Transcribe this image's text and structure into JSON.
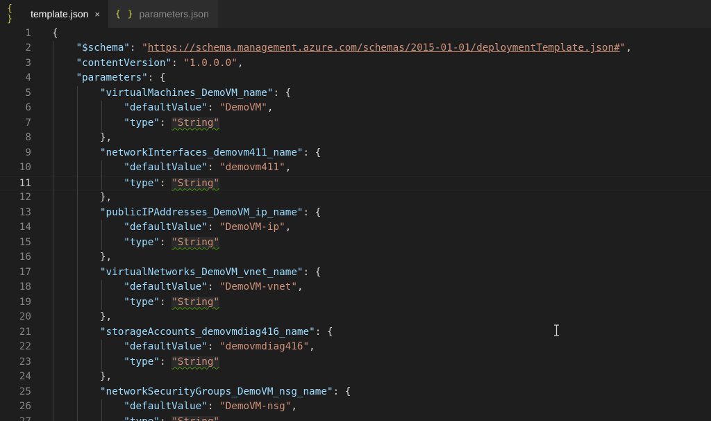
{
  "tabs": [
    {
      "icon": "{ }",
      "label": "template.json",
      "active": true,
      "close": "×"
    },
    {
      "icon": "{ }",
      "label": "parameters.json",
      "active": false
    }
  ],
  "editor": {
    "current_line": 11,
    "lines": [
      {
        "n": "1",
        "parts": [
          [
            "p",
            "{"
          ]
        ]
      },
      {
        "n": "2",
        "parts": [
          [
            "p",
            "    "
          ],
          [
            "k",
            "\"$schema\""
          ],
          [
            "p",
            ": "
          ],
          [
            "s",
            "\""
          ],
          [
            "u",
            "https://schema.management.azure.com/schemas/2015-01-01/deploymentTemplate.json#"
          ],
          [
            "s",
            "\""
          ],
          [
            "p",
            ","
          ]
        ]
      },
      {
        "n": "3",
        "parts": [
          [
            "p",
            "    "
          ],
          [
            "k",
            "\"contentVersion\""
          ],
          [
            "p",
            ": "
          ],
          [
            "s",
            "\"1.0.0.0\""
          ],
          [
            "p",
            ","
          ]
        ]
      },
      {
        "n": "4",
        "parts": [
          [
            "p",
            "    "
          ],
          [
            "k",
            "\"parameters\""
          ],
          [
            "p",
            ": {"
          ]
        ]
      },
      {
        "n": "5",
        "parts": [
          [
            "p",
            "        "
          ],
          [
            "k",
            "\"virtualMachines_DemoVM_name\""
          ],
          [
            "p",
            ": {"
          ]
        ]
      },
      {
        "n": "6",
        "parts": [
          [
            "p",
            "            "
          ],
          [
            "k",
            "\"defaultValue\""
          ],
          [
            "p",
            ": "
          ],
          [
            "s",
            "\"DemoVM\""
          ],
          [
            "p",
            ","
          ]
        ]
      },
      {
        "n": "7",
        "parts": [
          [
            "p",
            "            "
          ],
          [
            "k",
            "\"type\""
          ],
          [
            "p",
            ": "
          ],
          [
            "q",
            "\"String\""
          ]
        ]
      },
      {
        "n": "8",
        "parts": [
          [
            "p",
            "        },"
          ]
        ]
      },
      {
        "n": "9",
        "parts": [
          [
            "p",
            "        "
          ],
          [
            "k",
            "\"networkInterfaces_demovm411_name\""
          ],
          [
            "p",
            ": {"
          ]
        ]
      },
      {
        "n": "10",
        "parts": [
          [
            "p",
            "            "
          ],
          [
            "k",
            "\"defaultValue\""
          ],
          [
            "p",
            ": "
          ],
          [
            "s",
            "\"demovm411\""
          ],
          [
            "p",
            ","
          ]
        ]
      },
      {
        "n": "11",
        "parts": [
          [
            "p",
            "            "
          ],
          [
            "k",
            "\"type\""
          ],
          [
            "p",
            ": "
          ],
          [
            "q",
            "\"String\""
          ]
        ]
      },
      {
        "n": "12",
        "parts": [
          [
            "p",
            "        },"
          ]
        ]
      },
      {
        "n": "13",
        "parts": [
          [
            "p",
            "        "
          ],
          [
            "k",
            "\"publicIPAddresses_DemoVM_ip_name\""
          ],
          [
            "p",
            ": {"
          ]
        ]
      },
      {
        "n": "14",
        "parts": [
          [
            "p",
            "            "
          ],
          [
            "k",
            "\"defaultValue\""
          ],
          [
            "p",
            ": "
          ],
          [
            "s",
            "\"DemoVM-ip\""
          ],
          [
            "p",
            ","
          ]
        ]
      },
      {
        "n": "15",
        "parts": [
          [
            "p",
            "            "
          ],
          [
            "k",
            "\"type\""
          ],
          [
            "p",
            ": "
          ],
          [
            "q",
            "\"String\""
          ]
        ]
      },
      {
        "n": "16",
        "parts": [
          [
            "p",
            "        },"
          ]
        ]
      },
      {
        "n": "17",
        "parts": [
          [
            "p",
            "        "
          ],
          [
            "k",
            "\"virtualNetworks_DemoVM_vnet_name\""
          ],
          [
            "p",
            ": {"
          ]
        ]
      },
      {
        "n": "18",
        "parts": [
          [
            "p",
            "            "
          ],
          [
            "k",
            "\"defaultValue\""
          ],
          [
            "p",
            ": "
          ],
          [
            "s",
            "\"DemoVM-vnet\""
          ],
          [
            "p",
            ","
          ]
        ]
      },
      {
        "n": "19",
        "parts": [
          [
            "p",
            "            "
          ],
          [
            "k",
            "\"type\""
          ],
          [
            "p",
            ": "
          ],
          [
            "q",
            "\"String\""
          ]
        ]
      },
      {
        "n": "20",
        "parts": [
          [
            "p",
            "        },"
          ]
        ]
      },
      {
        "n": "21",
        "parts": [
          [
            "p",
            "        "
          ],
          [
            "k",
            "\"storageAccounts_demovmdiag416_name\""
          ],
          [
            "p",
            ": {"
          ]
        ]
      },
      {
        "n": "22",
        "parts": [
          [
            "p",
            "            "
          ],
          [
            "k",
            "\"defaultValue\""
          ],
          [
            "p",
            ": "
          ],
          [
            "s",
            "\"demovmdiag416\""
          ],
          [
            "p",
            ","
          ]
        ]
      },
      {
        "n": "23",
        "parts": [
          [
            "p",
            "            "
          ],
          [
            "k",
            "\"type\""
          ],
          [
            "p",
            ": "
          ],
          [
            "q",
            "\"String\""
          ]
        ]
      },
      {
        "n": "24",
        "parts": [
          [
            "p",
            "        },"
          ]
        ]
      },
      {
        "n": "25",
        "parts": [
          [
            "p",
            "        "
          ],
          [
            "k",
            "\"networkSecurityGroups_DemoVM_nsg_name\""
          ],
          [
            "p",
            ": {"
          ]
        ]
      },
      {
        "n": "26",
        "parts": [
          [
            "p",
            "            "
          ],
          [
            "k",
            "\"defaultValue\""
          ],
          [
            "p",
            ": "
          ],
          [
            "s",
            "\"DemoVM-nsg\""
          ],
          [
            "p",
            ","
          ]
        ]
      },
      {
        "n": "27",
        "parts": [
          [
            "p",
            "            "
          ],
          [
            "k",
            "\"type\""
          ],
          [
            "p",
            ": "
          ],
          [
            "q",
            "\"String\""
          ]
        ]
      }
    ]
  },
  "colors": {
    "background": "#1e1e1e",
    "key": "#9cdcfe",
    "string": "#ce9178",
    "punctuation": "#d4d4d4",
    "line_number": "#858585",
    "json_icon": "#cbcb41",
    "squiggle": "#4e9a06"
  },
  "icons": {
    "json_file": "json-file-icon",
    "close": "close-icon",
    "cursor": "text-cursor-icon"
  }
}
